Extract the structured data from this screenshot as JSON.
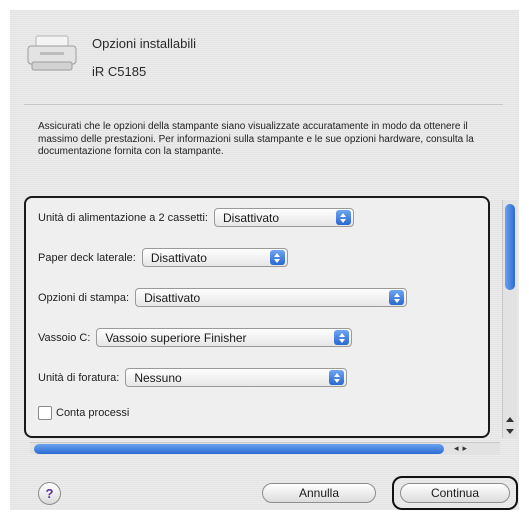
{
  "header": {
    "title": "Opzioni installabili",
    "printer": "iR C5185"
  },
  "description": "Assicurati che le opzioni della stampante siano visualizzate accuratamente in modo da ottenere il massimo delle prestazioni. Per informazioni sulla stampante e le sue opzioni hardware, consulta la documentazione fornita con la stampante.",
  "options": {
    "cassette_unit": {
      "label": "Unità di alimentazione a 2 cassetti:",
      "value": "Disattivato"
    },
    "paper_deck": {
      "label": "Paper deck laterale:",
      "value": "Disattivato"
    },
    "print_options": {
      "label": "Opzioni di stampa:",
      "value": "Disattivato"
    },
    "tray_c": {
      "label": "Vassoio C:",
      "value": "Vassoio superiore Finisher"
    },
    "puncher": {
      "label": "Unità di foratura:",
      "value": "Nessuno"
    },
    "job_count": {
      "label": "Conta processi",
      "checked": false
    }
  },
  "footer": {
    "help": "?",
    "cancel_label": "Annulla",
    "continue_label": "Continua"
  },
  "colors": {
    "accent": "#2c6bd3",
    "highlight_border": "#111111"
  }
}
